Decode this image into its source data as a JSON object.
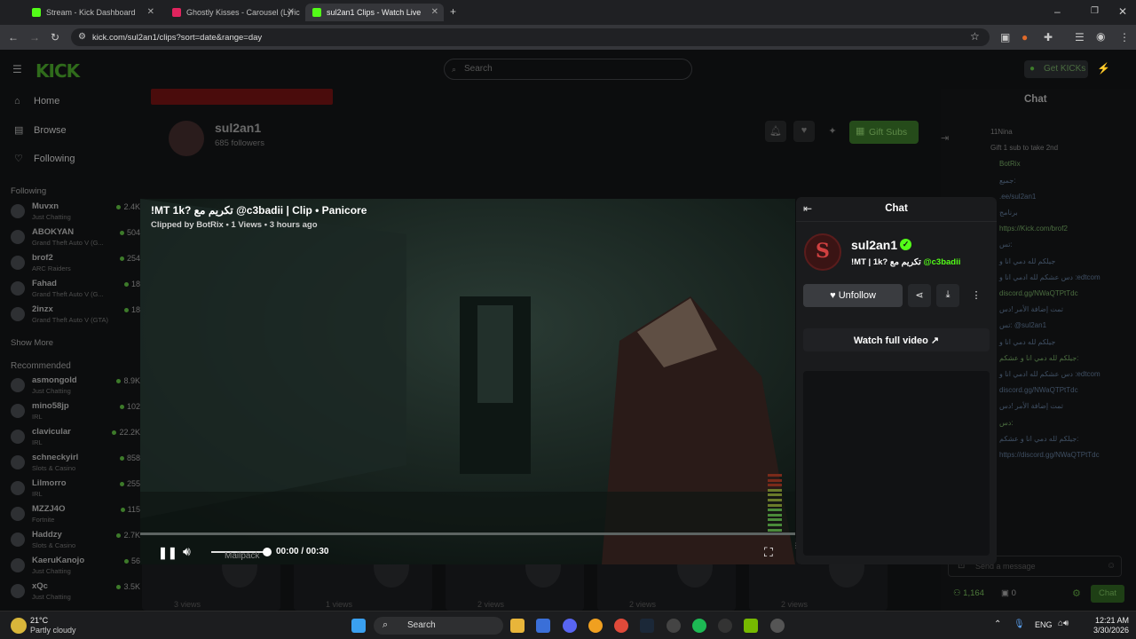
{
  "browser": {
    "tabs": [
      {
        "title": "Stream - Kick Dashboard",
        "active": false,
        "favicon_color": "#53fc18"
      },
      {
        "title": "Ghostly Kisses - Carousel (Lyric",
        "active": false,
        "favicon_color": "#e0245e"
      },
      {
        "title": "sul2an1 Clips - Watch Live",
        "active": true,
        "favicon_color": "#53fc18"
      }
    ],
    "url": "kick.com/sul2an1/clips?sort=date&range=day"
  },
  "site": {
    "search_placeholder": "Search",
    "get_kicks": "Get KICKs",
    "logo": "KICK",
    "nav": [
      {
        "label": "Home",
        "icon": "home-icon"
      },
      {
        "label": "Browse",
        "icon": "browse-icon"
      },
      {
        "label": "Following",
        "icon": "heart-icon"
      }
    ],
    "following_title": "Following",
    "following": [
      {
        "name": "Muvxn",
        "category": "Just Chatting",
        "viewers": "2.4K"
      },
      {
        "name": "ABOKYAN",
        "category": "Grand Theft Auto V (G...",
        "viewers": "504"
      },
      {
        "name": "brof2",
        "category": "ARC Raiders",
        "viewers": "254"
      },
      {
        "name": "Fahad",
        "category": "Grand Theft Auto V (G...",
        "viewers": "18"
      },
      {
        "name": "2inzx",
        "category": "Grand Theft Auto V (GTA)",
        "viewers": "18"
      }
    ],
    "show_more": "Show More",
    "recommended_title": "Recommended",
    "recommended": [
      {
        "name": "asmongold",
        "category": "Just Chatting",
        "viewers": "8.9K"
      },
      {
        "name": "mino58jp",
        "category": "IRL",
        "viewers": "102"
      },
      {
        "name": "clavicular",
        "category": "IRL",
        "viewers": "22.2K"
      },
      {
        "name": "schneckyirl",
        "category": "Slots & Casino",
        "viewers": "858"
      },
      {
        "name": "Lilmorro",
        "category": "IRL",
        "viewers": "255"
      },
      {
        "name": "MZZJ4O",
        "category": "Fortnite",
        "viewers": "115"
      },
      {
        "name": "Haddzy",
        "category": "Slots & Casino",
        "viewers": "2.7K"
      },
      {
        "name": "KaeruKanojo",
        "category": "Just Chatting",
        "viewers": "56"
      },
      {
        "name": "xQc",
        "category": "Just Chatting",
        "viewers": "3.5K"
      }
    ]
  },
  "channel": {
    "name": "sul2an1",
    "followers": "685 followers",
    "gift_subs": "Gift Subs"
  },
  "background_chat": {
    "title": "Chat",
    "lines": [
      "11Nina",
      "Gift 1 sub to take 2nd",
      "BotRix",
      "جميع: ",
      ".ee/sul2an1",
      "برنامج",
      "https://Kick.com/brof2",
      "تس:",
      "جيلكم لله دمي انا و",
      "دس عشكم لله ادمي انا و :edtcom",
      "discord.gg/NWaQTPtTdc",
      "تمت إضافة الأمر !دس",
      "تس: @sul2an1",
      "جيلكم لله دمي انا و",
      "جيلكم لله دمي انا و عشكم:",
      "دس عشكم لله ادمي انا و :edtcom",
      "discord.gg/NWaQTPtTdc",
      "تمت إضافة الأمر !دس",
      "دس:",
      "جيلكم لله دمي انا و عشكم:",
      "https://discord.gg/NWaQTPtTdc"
    ],
    "message_placeholder": "Send a message",
    "count_a": "1,164",
    "count_b": "0",
    "chat_button": "Chat"
  },
  "clips_row": [
    {
      "duration": "00:30",
      "views": "3 views"
    },
    {
      "duration": "02:13",
      "views": "1 views"
    },
    {
      "duration": "00:30",
      "views": "2 views"
    },
    {
      "duration": "00:30",
      "views": "2 views"
    },
    {
      "duration": "00:30",
      "views": "2 views"
    }
  ],
  "player": {
    "title": "!MT 1k? تكريم مع @c3badii | Clip • Panicore",
    "meta": "Clipped by BotRix • 1 Views • 3 hours ago",
    "time": "00:00 / 00:30",
    "progress_fraction": 0.0,
    "volume_fraction": 0.95,
    "overlay_text": "Mailpack"
  },
  "clip_panel": {
    "header": "Chat",
    "streamer": "sul2an1",
    "subtitle_prefix": "!MT | 1k? تكريم مع",
    "subtitle_mention": "@c3badii",
    "unfollow": "Unfollow",
    "watch_full": "Watch full video"
  },
  "taskbar": {
    "weather_temp": "21°C",
    "weather_desc": "Partly cloudy",
    "search": "Search",
    "lang": "ENG",
    "time": "12:21 AM",
    "date": "3/30/2026"
  }
}
